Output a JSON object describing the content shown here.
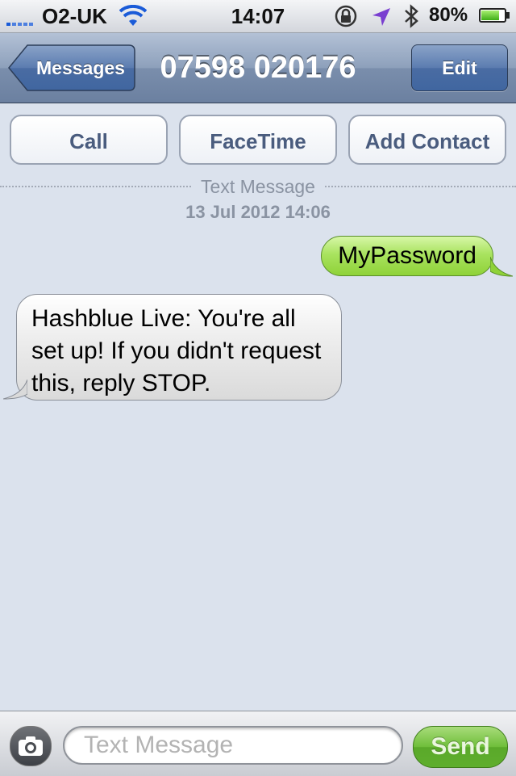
{
  "status_bar": {
    "carrier": "O2-UK",
    "time": "14:07",
    "battery_percent": "80%",
    "battery_level": 0.8,
    "icons": [
      "signal-icon",
      "wifi-icon",
      "rotation-lock-icon",
      "location-icon",
      "bluetooth-icon",
      "battery-icon"
    ]
  },
  "nav": {
    "back_label": "Messages",
    "title": "07598 020176",
    "edit_label": "Edit"
  },
  "actions": {
    "call": "Call",
    "facetime": "FaceTime",
    "add_contact": "Add Contact"
  },
  "conversation": {
    "type_label": "Text Message",
    "date": "13 Jul 2012 14:06",
    "messages": [
      {
        "direction": "sent",
        "text": "MyPassword"
      },
      {
        "direction": "received",
        "text": "Hashblue Live: You're all set up! If you didn't request this, reply STOP."
      }
    ]
  },
  "composer": {
    "placeholder": "Text Message",
    "value": "",
    "send_label": "Send",
    "camera_icon": "camera-icon"
  },
  "colors": {
    "background": "#dbe2ed",
    "sent_bubble": "#a9e35f",
    "received_bubble": "#e6e6e6",
    "nav_bar": "#8da0bb",
    "send_button": "#6fbe3a"
  }
}
